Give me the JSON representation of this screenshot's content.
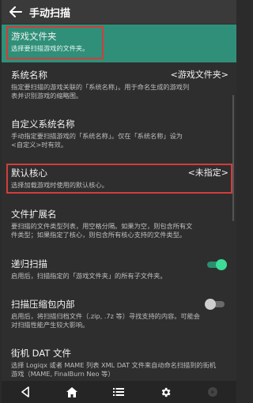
{
  "header": {
    "title": "手动扫描"
  },
  "items": [
    {
      "title": "游戏文件夹",
      "desc": "选择要扫描游戏的文件夹。"
    },
    {
      "title": "系统名称",
      "value": "<游戏文件夹>",
      "desc": "指定要扫描的游戏关联的「系统名称」。用于命名生成的游戏列\n表并识别游戏的缩略图。"
    },
    {
      "title": "自定义系统名称",
      "desc": "手动指定要扫描游戏的「系统名称」。仅在「系统名称」设为\n<自定义>时有效。"
    },
    {
      "title": "默认核心",
      "value": "<未指定>",
      "desc": "选择加载游戏时使用的默认核心。"
    },
    {
      "title": "文件扩展名",
      "desc": "要扫描的文件类型列表，用空格分隔。如果为空，则包含所有文\n件类型；如果指定了核心，则包含所有核心支持的文件类型。"
    },
    {
      "title": "递归扫描",
      "desc": "启用后，扫描指定的「游戏文件夹」的所有子文件夹。",
      "toggle": true
    },
    {
      "title": "扫描压缩包内部",
      "desc": "启用后，将扫描归档文件（.zip, .7z 等）寻找支持的内容。可能会\n对扫描性能产生较大影响。",
      "toggle": false
    },
    {
      "title": "街机 DAT 文件",
      "desc": "选择 Logiqx 或者 MAME 列表 XML DAT 文件来自动命名扫描到的街机\n游戏（MAME, FinalBurn Neo 等）"
    }
  ],
  "colors": {
    "highlight": "#2f8f78",
    "accent": "#3ddc97",
    "annotation": "#d33c3c"
  },
  "navbar": {
    "icons": [
      "back-triangle-icon",
      "home-icon",
      "list-icon",
      "gear-icon",
      "circle-icon"
    ]
  }
}
